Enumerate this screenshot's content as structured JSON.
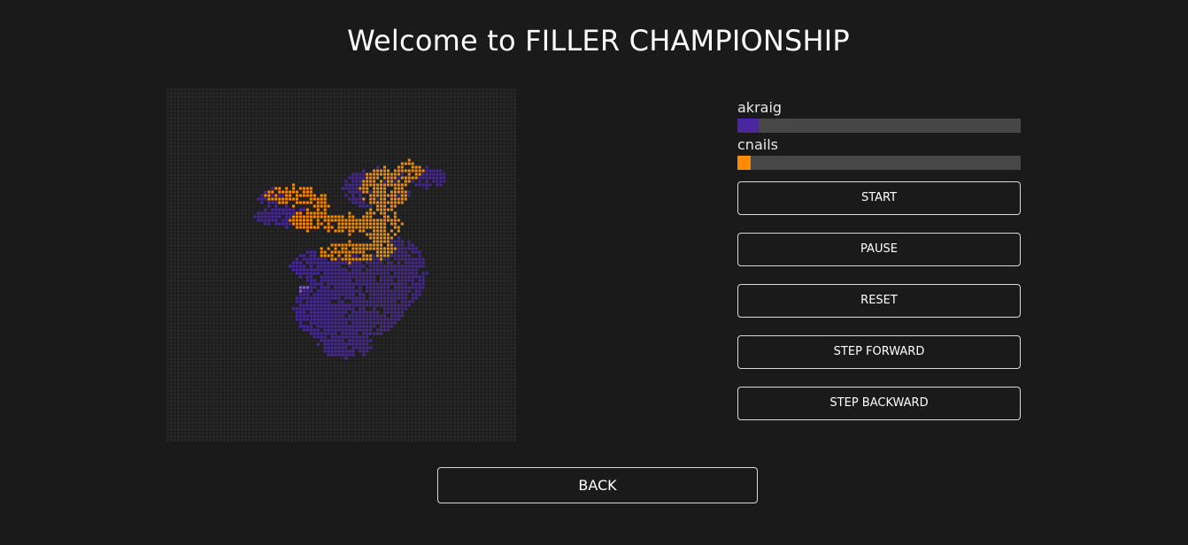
{
  "header": {
    "title": "Welcome to FILLER CHAMPIONSHIP"
  },
  "colors": {
    "background": "#1a1a1a",
    "board_empty": "#4a4a4a",
    "player1": "#4a27a0",
    "player2": "#ff8c00",
    "player1_last_piece": "#8a63d2",
    "progress_track": "#474747",
    "button_border": "#d9d9d9"
  },
  "board": {
    "cols": 100,
    "rows": 100
  },
  "players": [
    {
      "name": "akraig",
      "score_fraction": 0.075,
      "color": "#4a27a0"
    },
    {
      "name": "cnails",
      "score_fraction": 0.047,
      "color": "#ff8c00"
    }
  ],
  "controls": {
    "start_label": "START",
    "pause_label": "PAUSE",
    "reset_label": "RESET",
    "step_forward_label": "STEP FORWARD",
    "step_backward_label": "STEP BACKWARD"
  },
  "footer": {
    "back_label": "BACK"
  }
}
